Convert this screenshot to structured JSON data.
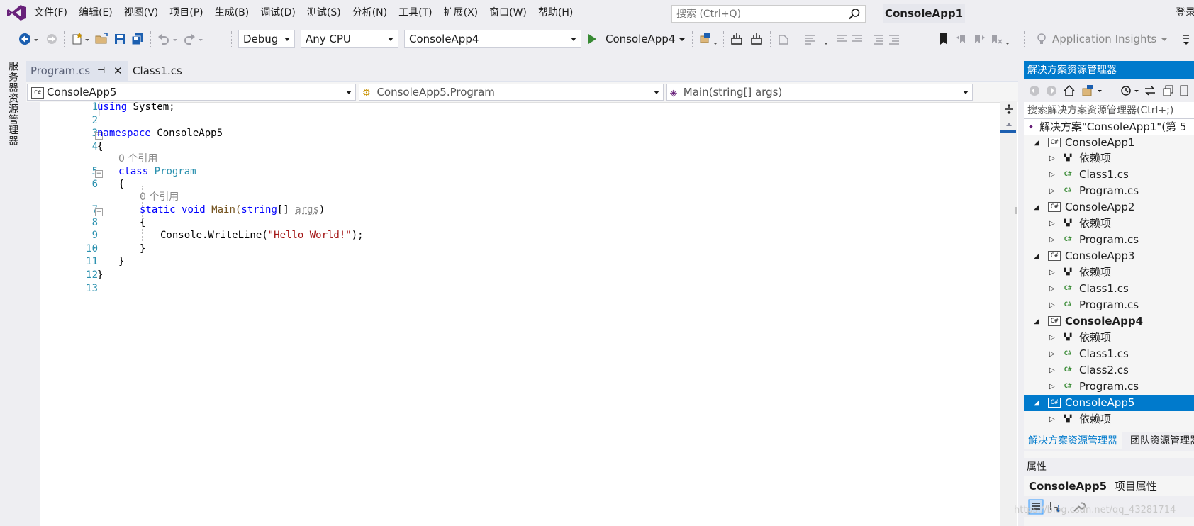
{
  "menu": {
    "items": [
      "文件(F)",
      "编辑(E)",
      "视图(V)",
      "项目(P)",
      "生成(B)",
      "调试(D)",
      "测试(S)",
      "分析(N)",
      "工具(T)",
      "扩展(X)",
      "窗口(W)",
      "帮助(H)"
    ],
    "search_placeholder": "搜索 (Ctrl+Q)",
    "app_title": "ConsoleApp1",
    "login": "登录"
  },
  "toolbar": {
    "config": "Debug",
    "platform": "Any CPU",
    "startup_project": "ConsoleApp4",
    "start_label": "ConsoleApp4",
    "insights_label": "Application Insights"
  },
  "side_tab": {
    "label": "服务器资源管理器"
  },
  "doc_tabs": {
    "active": "Program.cs",
    "inactive": "Class1.cs"
  },
  "navbar": {
    "project": "ConsoleApp5",
    "type": "ConsoleApp5.Program",
    "member": "Main(string[] args)"
  },
  "editor": {
    "line_numbers": [
      "1",
      "2",
      "3",
      "4",
      "5",
      "6",
      "7",
      "8",
      "9",
      "10",
      "11",
      "12",
      "13"
    ],
    "code": {
      "l1_kw": "using",
      "l1_rest": " System;",
      "l3_kw": "namespace",
      "l3_rest": " ConsoleApp5",
      "l4": "{",
      "ref1": "0 个引用",
      "l5_kw": "class",
      "l5_type": "Program",
      "l6": "{",
      "ref2": "0 个引用",
      "l7_kw1": "static",
      "l7_kw2": "void",
      "l7_name": "Main(",
      "l7_kw3": "string",
      "l7_rest": "[] ",
      "l7_args": "args",
      "l7_close": ")",
      "l8": "{",
      "l9_pre": "Console.WriteLine(",
      "l9_str": "\"Hello World!\"",
      "l9_post": ");",
      "l10": "}",
      "l11": "}",
      "l12": "}"
    }
  },
  "solution_explorer": {
    "title": "解决方案资源管理器",
    "search_placeholder": "搜索解决方案资源管理器(Ctrl+;)",
    "solution": "解决方案\"ConsoleApp1\"(第 5",
    "items": [
      {
        "label": "ConsoleApp1",
        "kind": "project",
        "bold": false
      },
      {
        "label": "依赖项",
        "kind": "deps"
      },
      {
        "label": "Class1.cs",
        "kind": "file"
      },
      {
        "label": "Program.cs",
        "kind": "file"
      },
      {
        "label": "ConsoleApp2",
        "kind": "project",
        "bold": false
      },
      {
        "label": "依赖项",
        "kind": "deps"
      },
      {
        "label": "Program.cs",
        "kind": "file"
      },
      {
        "label": "ConsoleApp3",
        "kind": "project",
        "bold": false
      },
      {
        "label": "依赖项",
        "kind": "deps"
      },
      {
        "label": "Class1.cs",
        "kind": "file"
      },
      {
        "label": "Program.cs",
        "kind": "file"
      },
      {
        "label": "ConsoleApp4",
        "kind": "project",
        "bold": true
      },
      {
        "label": "依赖项",
        "kind": "deps"
      },
      {
        "label": "Class1.cs",
        "kind": "file"
      },
      {
        "label": "Class2.cs",
        "kind": "file"
      },
      {
        "label": "Program.cs",
        "kind": "file"
      },
      {
        "label": "ConsoleApp5",
        "kind": "project",
        "bold": false,
        "selected": true
      },
      {
        "label": "依赖项",
        "kind": "deps"
      }
    ],
    "tab_active": "解决方案资源管理器",
    "tab_inactive": "团队资源管理器"
  },
  "properties": {
    "header": "属性",
    "title_name": "ConsoleApp5",
    "title_suffix": "项目属性"
  },
  "watermark": "https://blog.csdn.net/qq_43281714",
  "colors": {
    "accent": "#007acc",
    "keyword": "#0000ff",
    "type": "#2b91af",
    "string": "#a31515",
    "line_number": "#2b91af"
  }
}
